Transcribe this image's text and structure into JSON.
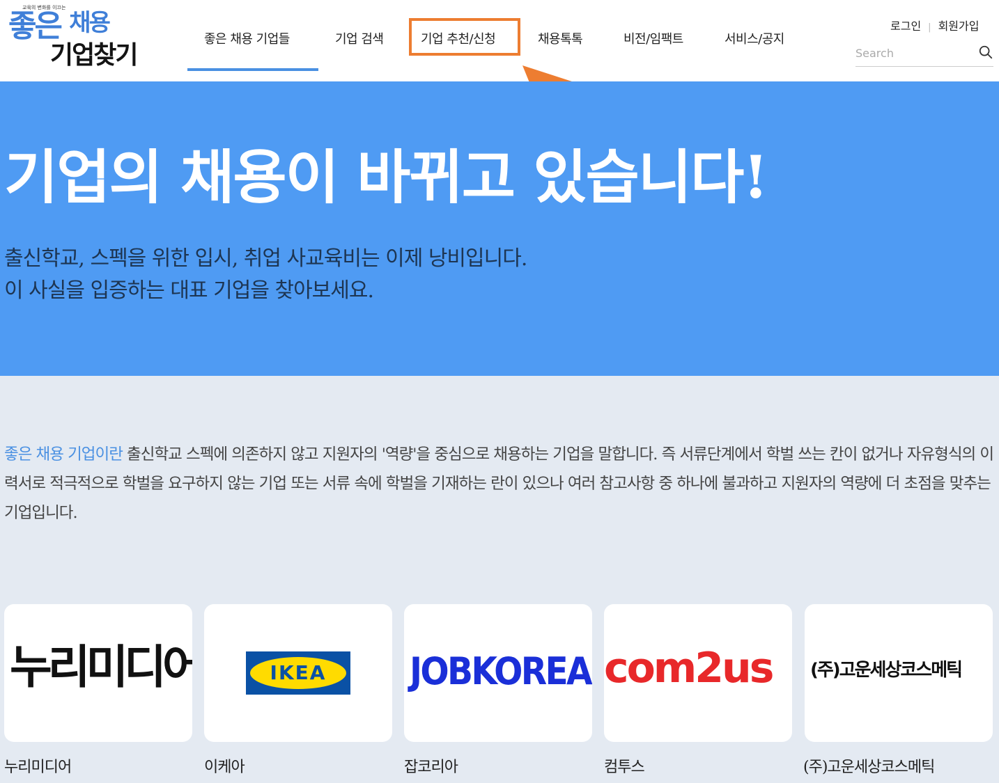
{
  "logo": {
    "tagline": "교육의 변화를 이끄는",
    "line1": "좋은",
    "line1_small": "채용",
    "line2": "기업찾기"
  },
  "nav": {
    "items": [
      {
        "label": "좋은 채용 기업들"
      },
      {
        "label": "기업 검색"
      },
      {
        "label": "기업 추천/신청"
      },
      {
        "label": "채용톡톡"
      },
      {
        "label": "비전/임팩트"
      },
      {
        "label": "서비스/공지"
      }
    ],
    "active_index": 0,
    "highlighted_index": 2
  },
  "account": {
    "login": "로그인",
    "signup": "회원가입"
  },
  "search": {
    "placeholder": "Search",
    "icon": "search-icon"
  },
  "hero": {
    "title": "기업의 채용이 바뀌고 있습니다!",
    "subtitle_line1": "출신학교, 스펙을 위한 입시, 취업 사교육비는 이제 낭비입니다.",
    "subtitle_line2": "이 사실을 입증하는 대표 기업을 찾아보세요."
  },
  "description": {
    "highlight": "좋은 채용 기업이란",
    "text": " 출신학교 스펙에 의존하지 않고 지원자의 '역량'을 중심으로 채용하는 기업을 말합니다. 즉 서류단계에서 학벌 쓰는 칸이 없거나 자유형식의 이력서로 적극적으로 학벌을 요구하지 않는 기업 또는 서류 속에 학벌을 기재하는 란이 있으나 여러 참고사항 중 하나에 불과하고 지원자의 역량에 더 초점을 맞추는 기업입니다."
  },
  "companies": [
    {
      "name": "누리미디어",
      "logo_text": "누리미디어"
    },
    {
      "name": "이케아",
      "logo_text": "IKEA"
    },
    {
      "name": "잡코리아",
      "logo_text": "JOBKOREA"
    },
    {
      "name": "컴투스",
      "logo_text": "com2us"
    },
    {
      "name": "(주)고운세상코스메틱",
      "logo_text": "(주)고운세상코스메틱"
    }
  ],
  "colors": {
    "accent": "#4a90e2",
    "hero_bg": "#4f9bf3",
    "page_bg": "#e4eaf2",
    "highlight_box": "#ed7d31"
  }
}
